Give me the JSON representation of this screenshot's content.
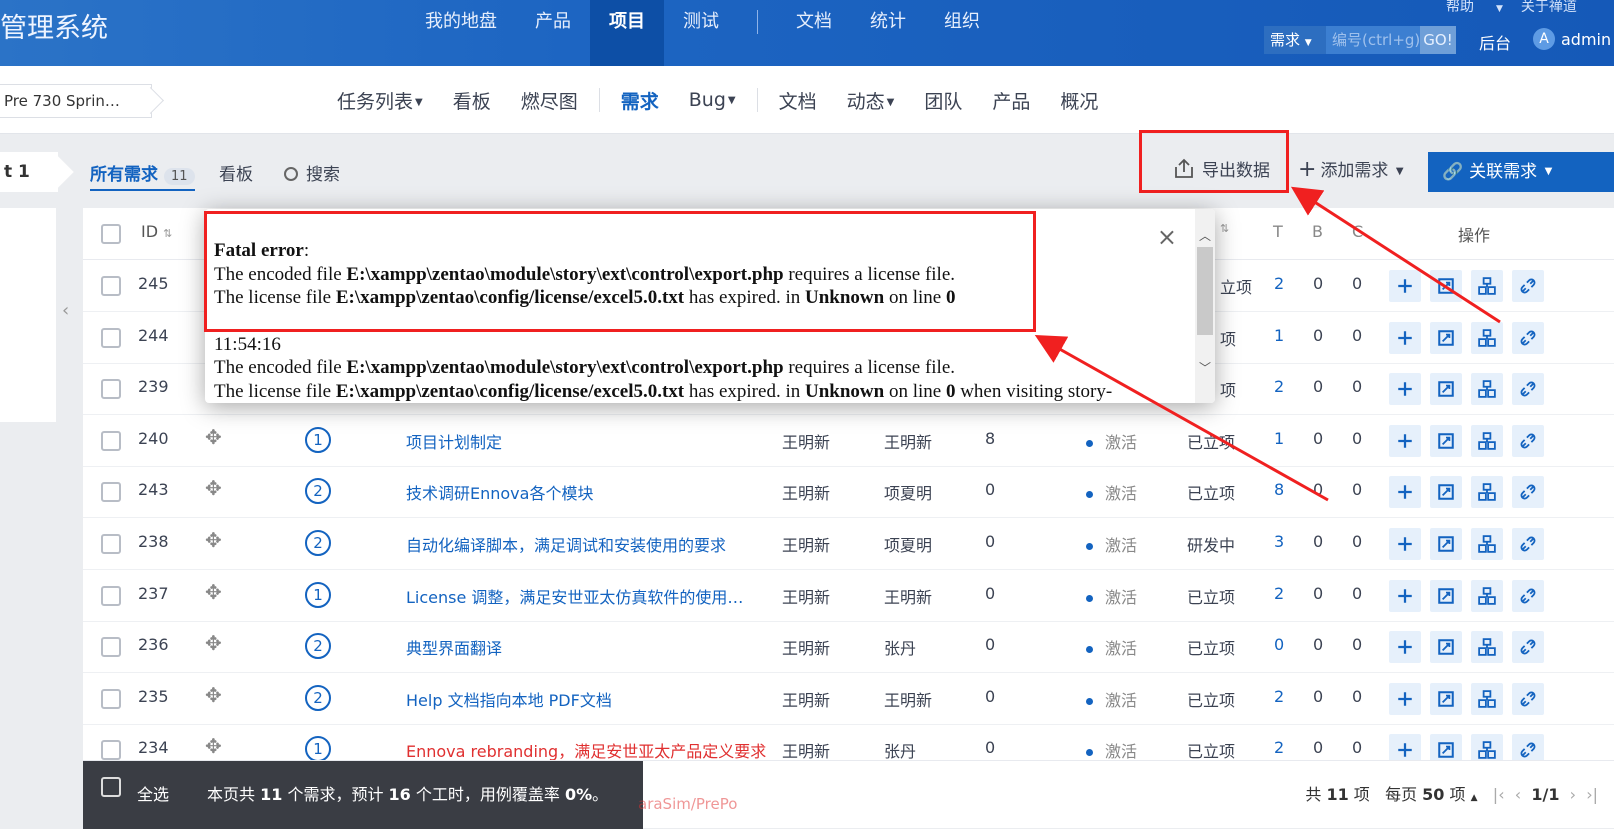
{
  "topbar": {
    "system_name": "项目管理系统",
    "nav": [
      "我的地盘",
      "产品",
      "项目",
      "测试",
      "文档",
      "统计",
      "组织"
    ],
    "active_nav": "项目",
    "help": "帮助",
    "about": "关于禅道",
    "search": {
      "type": "需求",
      "placeholder": "编号(ctrl+g)",
      "go": "GO!"
    },
    "admin_link": "后台",
    "user_initial": "A",
    "user_name": "admin"
  },
  "subbar": {
    "project": "Pre 730 Sprin…",
    "nav": [
      {
        "label": "任务列表",
        "caret": true
      },
      {
        "label": "看板",
        "caret": false
      },
      {
        "label": "燃尽图",
        "caret": false
      },
      {
        "label": "需求",
        "caret": false,
        "active": true
      },
      {
        "label": "Bug",
        "caret": true
      },
      {
        "label": "文档",
        "caret": false
      },
      {
        "label": "动态",
        "caret": true
      },
      {
        "label": "团队",
        "caret": false
      },
      {
        "label": "产品",
        "caret": false
      },
      {
        "label": "概况",
        "caret": false
      }
    ]
  },
  "featurebar": {
    "left_tab": "t 1",
    "tab_all": "所有需求",
    "tab_all_count": "11",
    "tab_board": "看板",
    "tab_search": "搜索",
    "export": "导出数据",
    "add_story": "添加需求",
    "link_story": "关联需求"
  },
  "table": {
    "headers": {
      "id": "ID",
      "t": "T",
      "b": "B",
      "c": "C",
      "actions": "操作"
    },
    "rows": [
      {
        "id": "245",
        "pri": "",
        "title": "",
        "opened": "",
        "assigned": "",
        "estimate": "",
        "status": "",
        "stage": "立项",
        "t": "2",
        "b": "0",
        "c": "0"
      },
      {
        "id": "244",
        "pri": "",
        "title": "",
        "opened": "",
        "assigned": "",
        "estimate": "",
        "status": "",
        "stage": "项",
        "t": "1",
        "b": "0",
        "c": "0"
      },
      {
        "id": "239",
        "pri": "",
        "title": "",
        "opened": "",
        "assigned": "",
        "estimate": "",
        "status": "",
        "stage": "项",
        "t": "2",
        "b": "0",
        "c": "0"
      },
      {
        "id": "240",
        "pri": "1",
        "title": "项目计划制定",
        "opened": "王明新",
        "assigned": "王明新",
        "estimate": "8",
        "status": "激活",
        "stage": "已立项",
        "t": "1",
        "b": "0",
        "c": "0"
      },
      {
        "id": "243",
        "pri": "2",
        "title": "技术调研Ennova各个模块",
        "opened": "王明新",
        "assigned": "项夏明",
        "estimate": "0",
        "status": "激活",
        "stage": "已立项",
        "t": "8",
        "b": "0",
        "c": "0"
      },
      {
        "id": "238",
        "pri": "2",
        "title": "自动化编译脚本，满足调试和安装使用的要求",
        "opened": "王明新",
        "assigned": "项夏明",
        "estimate": "0",
        "status": "激活",
        "stage": "研发中",
        "t": "3",
        "b": "0",
        "c": "0"
      },
      {
        "id": "237",
        "pri": "1",
        "title": "License 调整，满足安世亚太仿真软件的使用…",
        "opened": "王明新",
        "assigned": "王明新",
        "estimate": "0",
        "status": "激活",
        "stage": "已立项",
        "t": "2",
        "b": "0",
        "c": "0"
      },
      {
        "id": "236",
        "pri": "2",
        "title": "典型界面翻译",
        "opened": "王明新",
        "assigned": "张丹",
        "estimate": "0",
        "status": "激活",
        "stage": "已立项",
        "t": "0",
        "b": "0",
        "c": "0"
      },
      {
        "id": "235",
        "pri": "2",
        "title": "Help 文档指向本地 PDF文档",
        "opened": "王明新",
        "assigned": "王明新",
        "estimate": "0",
        "status": "激活",
        "stage": "已立项",
        "t": "2",
        "b": "0",
        "c": "0"
      },
      {
        "id": "234",
        "pri": "1",
        "title": "Ennova rebranding，满足安世亚太产品定义要求",
        "opened": "王明新",
        "assigned": "张丹",
        "estimate": "0",
        "status": "激活",
        "stage": "已立项",
        "t": "2",
        "b": "0",
        "c": "0",
        "red": true
      }
    ]
  },
  "footer": {
    "select_all": "全选",
    "summary_pre": "本页共 ",
    "summary_count": "11",
    "summary_mid": " 个需求，预计 ",
    "summary_hours": "16",
    "summary_mid2": " 个工时，用例覆盖率 ",
    "summary_rate": "0%",
    "summary_end": "。",
    "total_pre": "共 ",
    "total": "11",
    "total_unit": " 项",
    "per_page_pre": "每页 ",
    "per_page": "50",
    "per_page_unit": " 项",
    "page": "1/1",
    "peek_title": "araSim/PrePo"
  },
  "error_dialog": {
    "close": "×",
    "label": "Fatal error",
    "colon": ":",
    "line1_pre": "The encoded file ",
    "line1_path": "E:\\xampp\\zentao\\module\\story\\ext\\control\\export.php",
    "line1_post": " requires a license file.",
    "line2_pre": "The license file ",
    "line2_path": "E:\\xampp\\zentao\\config/license/excel5.0.txt",
    "line2_mid": " has expired. in ",
    "line2_unknown": "Unknown",
    "line2_on": " on line ",
    "line2_num": "0",
    "time": "11:54:16",
    "line3_pre": "The encoded file ",
    "line3_path": "E:\\xampp\\zentao\\module\\story\\ext\\control\\export.php",
    "line3_post": " requires a license file.",
    "line4_pre": "The license file ",
    "line4_path": "E:\\xampp\\zentao\\config/license/excel5.0.txt",
    "line4_mid": " has expired. in ",
    "line4_unknown": "Unknown",
    "line4_on": " on line ",
    "line4_num": "0",
    "line4_tail": " when visiting story-"
  },
  "colors": {
    "primary": "#1363c0",
    "annotation_red": "#f02020"
  }
}
